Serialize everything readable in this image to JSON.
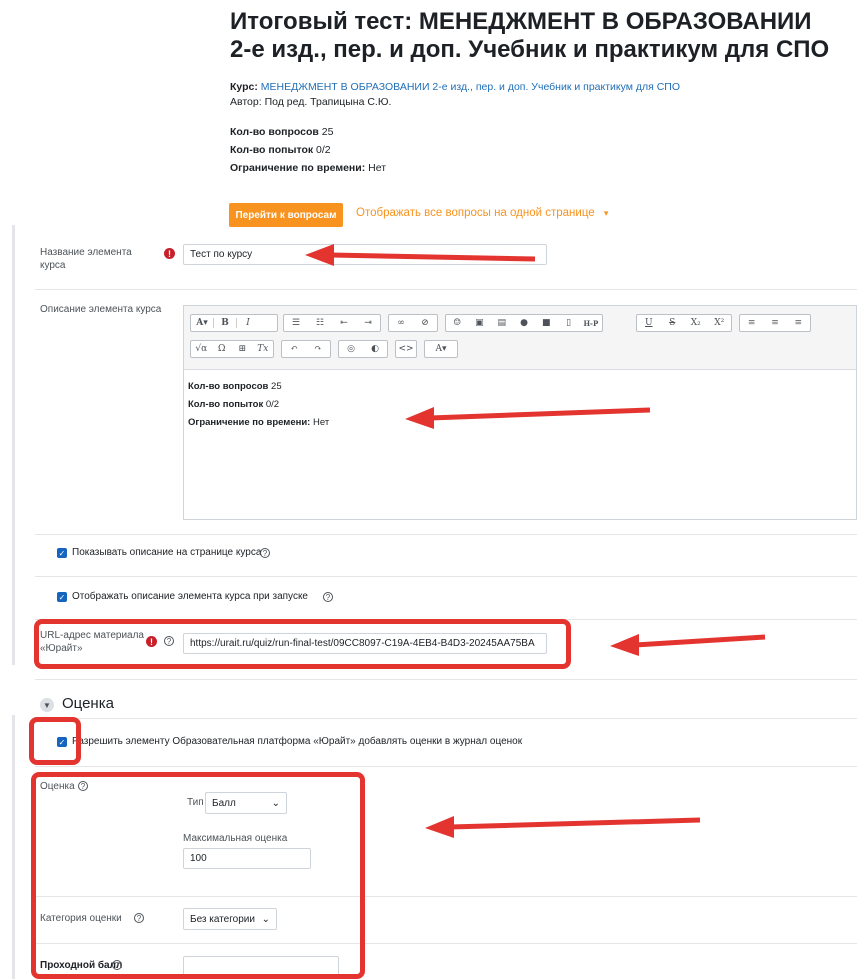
{
  "header": {
    "title_line1": "Итоговый тест: МЕНЕДЖМЕНТ В ОБРАЗОВАНИИ",
    "title_line2": "2-е изд., пер. и доп. Учебник и практикум для СПО",
    "course_label": "Курс:",
    "course_value": "МЕНЕДЖМЕНТ В ОБРАЗОВАНИИ 2-е изд., пер. и доп. Учебник и практикум для СПО",
    "author_label": "Автор:",
    "author_value": "Под ред. Трапицына С.Ю.",
    "questions_label": "Кол-во вопросов",
    "questions_value": "25",
    "attempts_label": "Кол-во попыток",
    "attempts_value": "0/2",
    "time_label": "Ограничение по времени:",
    "time_value": "Нет",
    "go_button": "Перейти к вопросам",
    "show_all_link": "Отображать все вопросы на одной странице",
    "show_all_caret": "▾"
  },
  "form": {
    "name_label": "Название элемента курса",
    "name_value": "Тест по курсу",
    "desc_label": "Описание элемента курса",
    "editor_text": {
      "questions_label": "Кол-во вопросов",
      "questions_value": "25",
      "attempts_label": "Кол-во попыток",
      "attempts_value": "0/2",
      "time_label": "Ограничение по времени:",
      "time_value": "Нет"
    },
    "show_desc_label": "Показывать описание на странице курса",
    "show_desc_on_launch_label": "Отображать описание элемента курса при запуске",
    "url_label": "URL-адрес материала «Юрайт»",
    "url_value": "https://urait.ru/quiz/run-final-test/09CC8097-C19A-4EB4-B4D3-20245AA75BA"
  },
  "grade_section": {
    "title": "Оценка",
    "allow_label": "Разрешить элементу Образовательная платформа «Юрайт» добавлять оценки в журнал оценок",
    "grade_label": "Оценка",
    "type_label": "Тип",
    "type_value": "Балл",
    "max_label": "Максимальная оценка",
    "max_value": "100",
    "category_label": "Категория оценки",
    "category_value": "Без категории",
    "pass_label": "Проходной балл",
    "pass_value": ""
  },
  "toolbar_icons": [
    "font-style",
    "bold",
    "italic",
    "bullet-list",
    "numbered-list",
    "indent",
    "outdent",
    "link",
    "unlink",
    "emoji",
    "image",
    "media",
    "record-audio",
    "record-video",
    "manage-files",
    "h5p",
    "underline",
    "strike",
    "subscript",
    "superscript",
    "align-left",
    "align-center",
    "align-right",
    "equation",
    "special-char",
    "table",
    "clear-format",
    "undo",
    "redo",
    "accessibility-checker",
    "screenreader-helper",
    "html",
    "font-color"
  ],
  "colors": {
    "accent": "#f7931e",
    "link": "#1f6fb8",
    "annotation": "#e3342f",
    "required": "#c8202a"
  }
}
